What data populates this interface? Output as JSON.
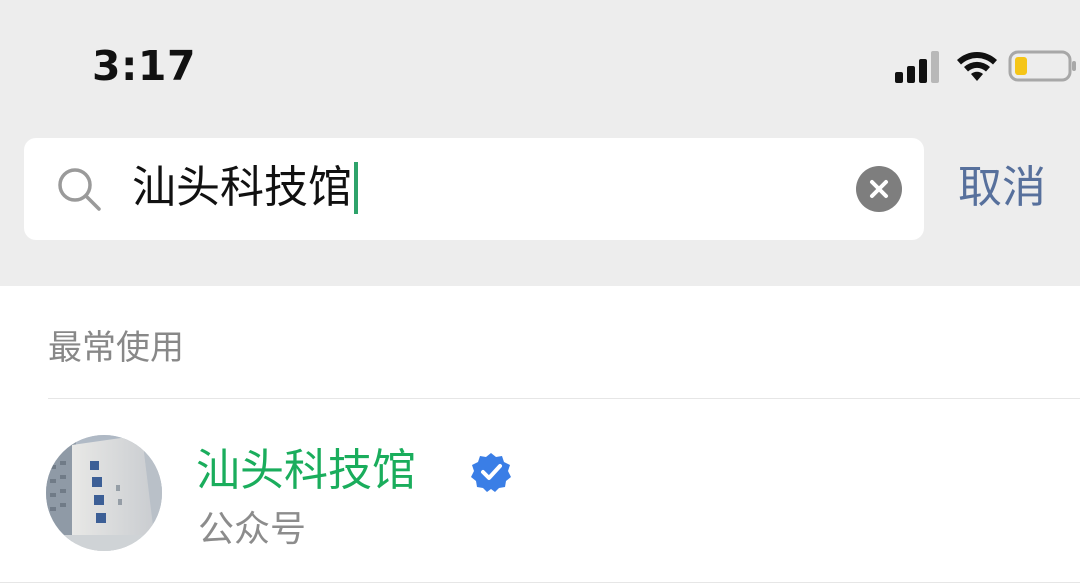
{
  "status_bar": {
    "time": "3:17",
    "signal_icon": "cellular-signal-icon",
    "wifi_icon": "wifi-icon",
    "battery_icon": "battery-low-icon",
    "battery_level": 0.2,
    "battery_color": "#f5c518"
  },
  "search": {
    "query": "汕头科技馆",
    "search_icon": "search-icon",
    "clear_icon": "clear-icon",
    "cancel_label": "取消",
    "caret_color": "#2ea36b"
  },
  "section": {
    "title": "最常使用"
  },
  "results": [
    {
      "title": "汕头科技馆",
      "subtitle": "公众号",
      "verified": true,
      "avatar_icon": "building-avatar",
      "title_color": "#1aad5c",
      "verified_color": "#3a7ee6"
    }
  ],
  "colors": {
    "header_bg": "#ededed",
    "link": "#57709c"
  }
}
